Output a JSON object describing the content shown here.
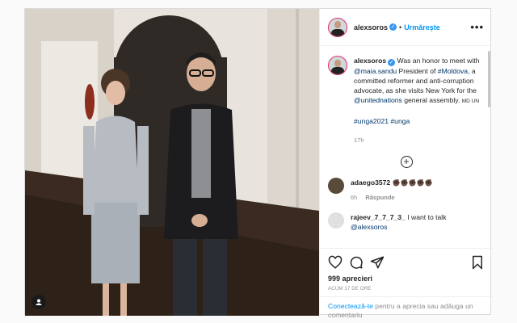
{
  "post": {
    "username": "alexsoros",
    "verified_icon": "verified-badge-icon",
    "dot": "•",
    "follow_label": "Urmărește",
    "more_label": "•••"
  },
  "caption": {
    "username": "alexsoros",
    "part1": "Was an honor to meet with ",
    "mention1": "@maia.sandu",
    "part2": " President of ",
    "hashtag1": "#Moldova",
    "part3": ", a committed reformer and anti-corruption advocate, as she visits New York for the ",
    "mention2": "@unitednations",
    "part4": " general assembly. ",
    "flags": "MD UN",
    "hashtags": "#unga2021 #unga",
    "time": "17h"
  },
  "load_more_label": "+",
  "comments": [
    {
      "username": "adaego3572",
      "text": "✊🏿✊🏿✊🏿✊🏿✊🏿",
      "time": "6h",
      "reply_label": "Răspunde"
    },
    {
      "username": "rajeev_7_7_7_3_",
      "text": "I want to talk",
      "mention": "@alexsoros"
    }
  ],
  "actions": {
    "likes": "999 aprecieri",
    "ago": "ACUM 17 DE ORE"
  },
  "login": {
    "link_label": "Conectează-te",
    "rest": " pentru a aprecia sau adăuga un comentariu"
  },
  "colors": {
    "accent": "#0095f6",
    "link": "#00376b",
    "verified": "#3897f0"
  }
}
